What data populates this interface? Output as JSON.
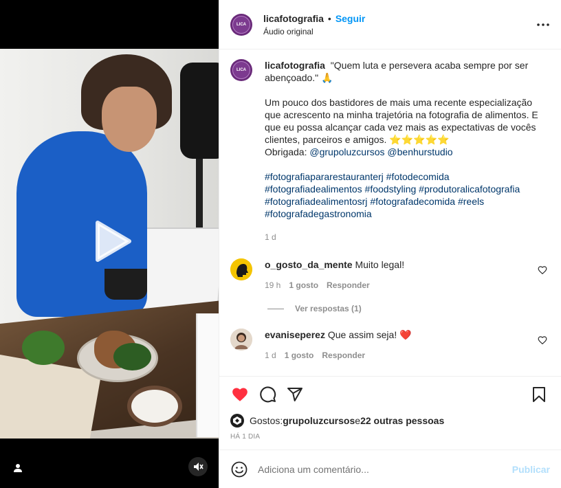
{
  "post": {
    "username": "licafotografia",
    "follow_label": "Seguir",
    "audio_label": "Áudio original",
    "avatar_text": "LICA",
    "caption_lines": [
      "\"Quem luta e persevera acaba sempre por ser abençoado.\" 🙏",
      "",
      "Um pouco dos bastidores de mais uma recente especialização que acrescento na minha trajetória na fotografia de alimentos. E que eu possa alcançar cada vez mais as expectativas de vocês clientes, parceiros e amigos. ⭐⭐⭐⭐⭐"
    ],
    "thanks_prefix": "Obrigada: ",
    "mentions": [
      "@grupoluzcursos",
      "@benhurstudio"
    ],
    "hashtags": [
      "#fotografiapararestauranterj",
      "#fotodecomida",
      "#fotografiadealimentos",
      "#foodstyling",
      "#produtoralicafotografia",
      "#fotografiadealimentosrj",
      "#fotografadecomida",
      "#reels",
      "#fotografadegastronomia"
    ],
    "time_ago": "1 d"
  },
  "comments": [
    {
      "username": "o_gosto_da_mente",
      "text": "Muito legal!",
      "time": "19 h",
      "likes": "1 gosto",
      "reply_label": "Responder",
      "view_replies": "Ver respostas (1)"
    },
    {
      "username": "evaniseperez",
      "text": "Que assim seja! ❤️",
      "time": "1 d",
      "likes": "1 gosto",
      "reply_label": "Responder"
    }
  ],
  "likes": {
    "prefix": "Gostos: ",
    "user": "grupoluzcursos",
    "middle": " e ",
    "others": "22 outras pessoas"
  },
  "date_label": "HÁ 1 DIA",
  "comment_box": {
    "placeholder": "Adiciona um comentário...",
    "publish_label": "Publicar"
  },
  "colors": {
    "accent": "#0095f6",
    "like_red": "#ff3040",
    "avatar_purple": "#6a2b7a",
    "hashtag": "#00376b"
  },
  "icons": [
    "play-icon",
    "user-tag-icon",
    "mute-icon",
    "more-icon",
    "heart-icon",
    "comment-icon",
    "share-icon",
    "bookmark-icon",
    "emoji-icon"
  ]
}
